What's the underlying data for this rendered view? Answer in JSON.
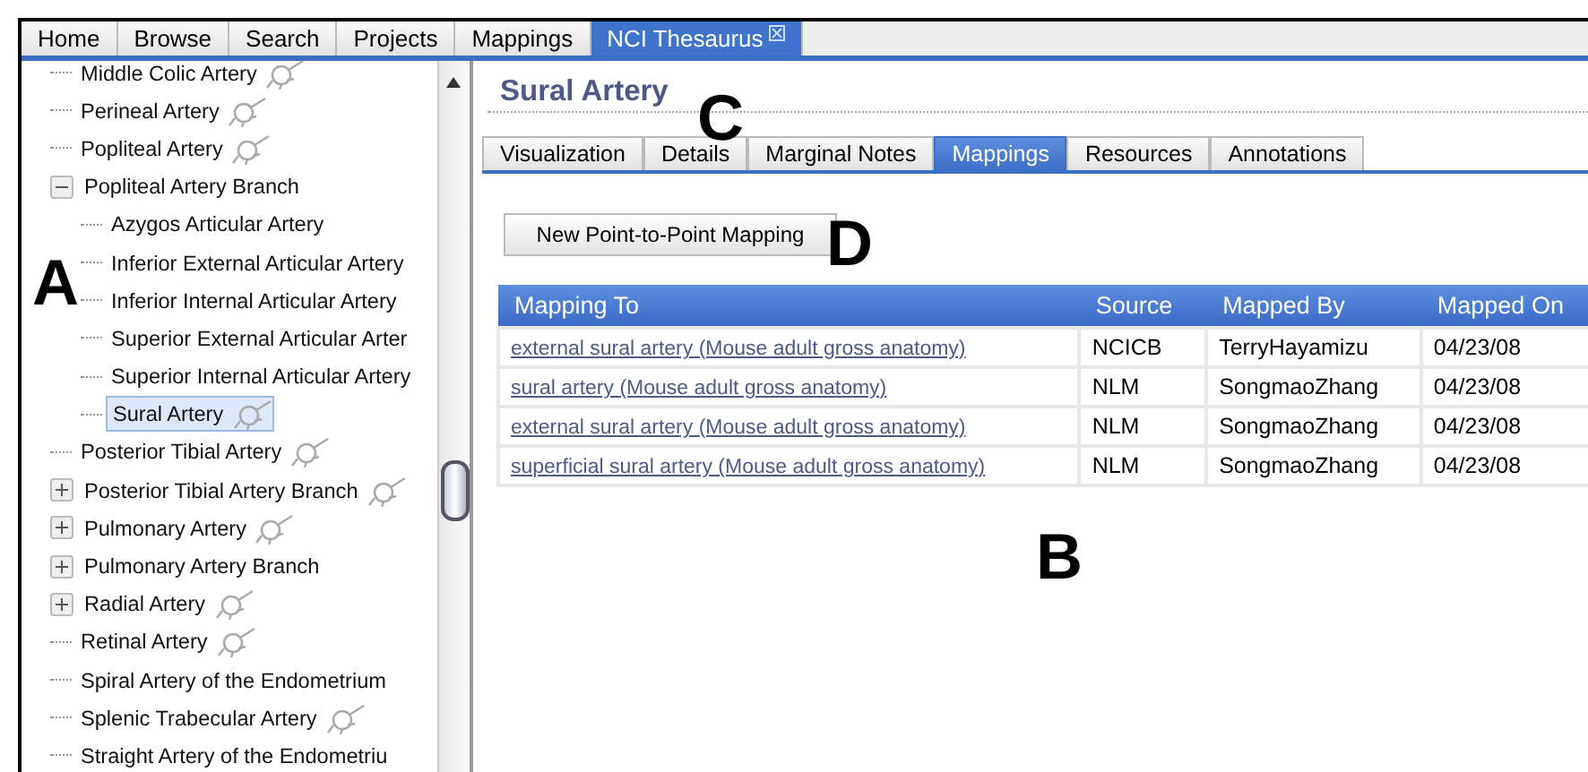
{
  "top_tabs": [
    {
      "label": "Home",
      "selected": false
    },
    {
      "label": "Browse",
      "selected": false
    },
    {
      "label": "Search",
      "selected": false
    },
    {
      "label": "Projects",
      "selected": false
    },
    {
      "label": "Mappings",
      "selected": false
    },
    {
      "label": "NCI Thesaurus",
      "selected": true,
      "closable": true
    }
  ],
  "tree": {
    "items": [
      {
        "label": "Middle Colic Artery",
        "icon": true,
        "selected": false
      },
      {
        "label": "Perineal Artery",
        "icon": true,
        "selected": false
      },
      {
        "label": "Popliteal Artery",
        "icon": true,
        "selected": false
      },
      {
        "label": "Popliteal Artery Branch",
        "icon": false,
        "selected": false,
        "expanded": true,
        "children": [
          {
            "label": "Azygos Articular Artery",
            "icon": false,
            "selected": false
          },
          {
            "label": "Inferior External Articular Artery",
            "icon": false,
            "selected": false
          },
          {
            "label": "Inferior Internal Articular Artery",
            "icon": false,
            "selected": false
          },
          {
            "label": "Superior External Articular Arter",
            "icon": false,
            "selected": false
          },
          {
            "label": "Superior Internal Articular Artery",
            "icon": false,
            "selected": false
          },
          {
            "label": "Sural Artery",
            "icon": true,
            "selected": true
          }
        ]
      },
      {
        "label": "Posterior Tibial Artery",
        "icon": true,
        "selected": false
      },
      {
        "label": "Posterior Tibial Artery Branch",
        "icon": true,
        "selected": false,
        "expanded": false
      },
      {
        "label": "Pulmonary Artery",
        "icon": true,
        "selected": false,
        "expanded": false
      },
      {
        "label": "Pulmonary Artery Branch",
        "icon": false,
        "selected": false,
        "expanded": false
      },
      {
        "label": "Radial Artery",
        "icon": true,
        "selected": false,
        "expanded": false
      },
      {
        "label": "Retinal Artery",
        "icon": true,
        "selected": false
      },
      {
        "label": "Spiral Artery of the Endometrium",
        "icon": false,
        "selected": false
      },
      {
        "label": "Splenic Trabecular Artery",
        "icon": true,
        "selected": false
      },
      {
        "label": "Straight Artery of the Endometriu",
        "icon": false,
        "selected": false
      }
    ]
  },
  "concept": {
    "title": "Sural Artery",
    "tabs": [
      {
        "label": "Visualization",
        "selected": false
      },
      {
        "label": "Details",
        "selected": false
      },
      {
        "label": "Marginal Notes",
        "selected": false
      },
      {
        "label": "Mappings",
        "selected": true
      },
      {
        "label": "Resources",
        "selected": false
      },
      {
        "label": "Annotations",
        "selected": false
      }
    ],
    "button": "New Point-to-Point Mapping",
    "table": {
      "columns": [
        "Mapping To",
        "Source",
        "Mapped By",
        "Mapped On"
      ],
      "rows": [
        [
          "external sural artery (Mouse adult gross anatomy)",
          "NCICB",
          "TerryHayamizu",
          "04/23/08"
        ],
        [
          "sural artery (Mouse adult gross anatomy)",
          "NLM",
          "SongmaoZhang",
          "04/23/08"
        ],
        [
          "external sural artery (Mouse adult gross anatomy)",
          "NLM",
          "SongmaoZhang",
          "04/23/08"
        ],
        [
          "superficial sural artery (Mouse adult gross anatomy)",
          "NLM",
          "SongmaoZhang",
          "04/23/08"
        ]
      ]
    }
  },
  "callouts": [
    "A",
    "B",
    "C",
    "D"
  ]
}
